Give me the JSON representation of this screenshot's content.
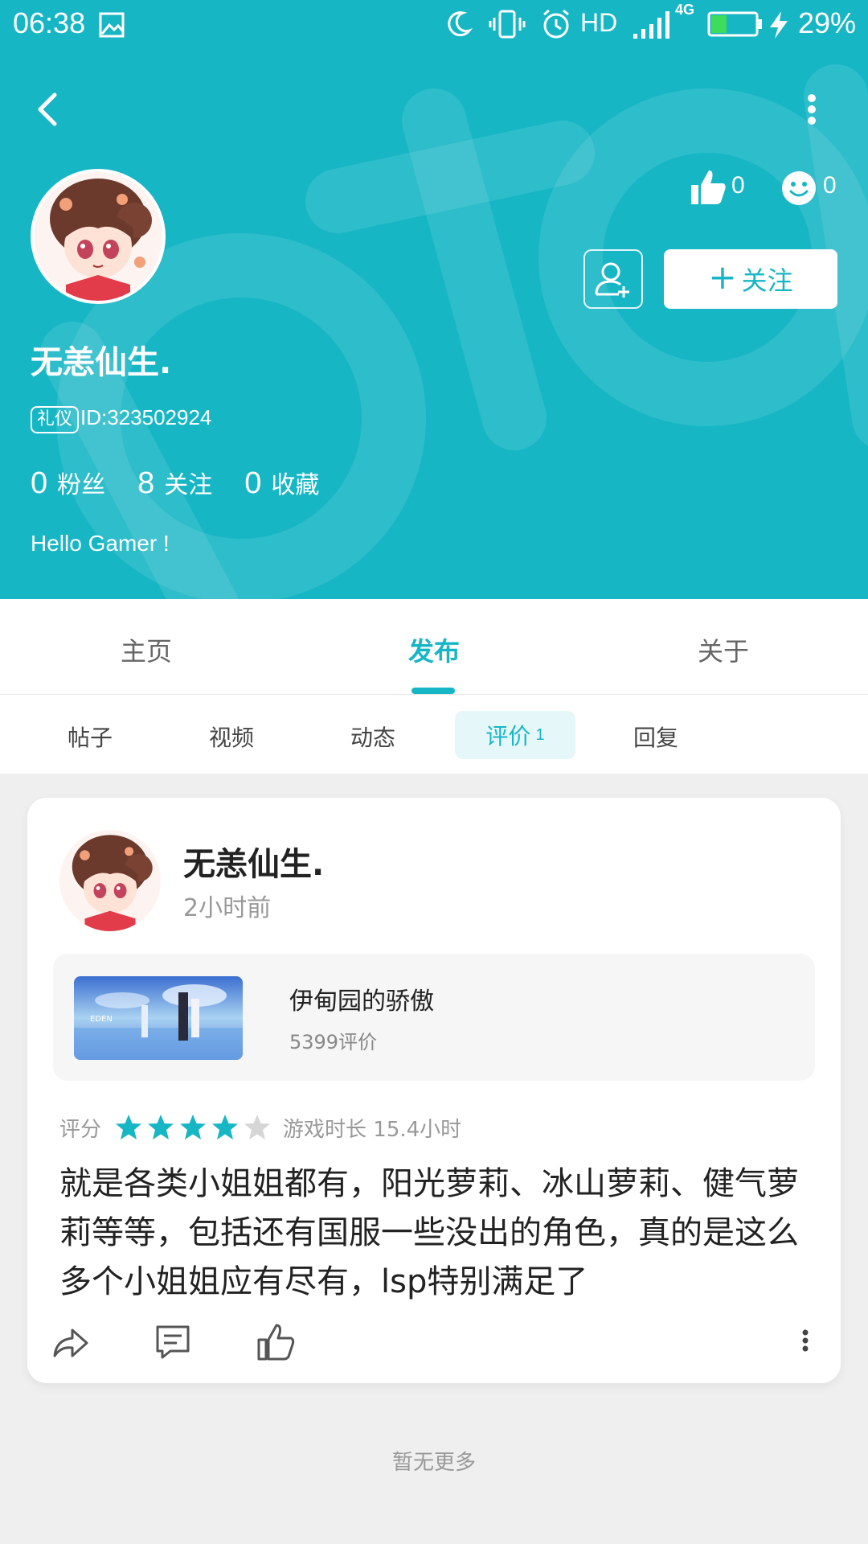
{
  "status_bar": {
    "time": "06:38",
    "hd": "HD",
    "network": "4G",
    "battery_percent": "29%"
  },
  "profile": {
    "username": "无恙仙生.",
    "tag": "礼仪",
    "id_text": "ID:323502924",
    "likes": "0",
    "smiles": "0",
    "follow_label": "关注",
    "follow_plus": "+",
    "counts": [
      {
        "num": "0",
        "label": "粉丝"
      },
      {
        "num": "8",
        "label": "关注"
      },
      {
        "num": "0",
        "label": "收藏"
      }
    ],
    "bio": "Hello Gamer !"
  },
  "tabs": [
    "主页",
    "发布",
    "关于"
  ],
  "active_tab": "发布",
  "subtabs": [
    "帖子",
    "视频",
    "动态",
    "回复"
  ],
  "active_subtab": {
    "label": "评价",
    "count": "1"
  },
  "review_card": {
    "author": "无恙仙生.",
    "time": "2小时前",
    "game": {
      "title": "伊甸园的骄傲",
      "review_count": "5399评价"
    },
    "rating_label": "评分",
    "rating": 4,
    "rating_max": 5,
    "playtime": "游戏时长 15.4小时",
    "content": "就是各类小姐姐都有，阳光萝莉、冰山萝莉、健气萝莉等等，包括还有国服一些没出的角色，真的是这么多个小姐姐应有尽有，lsp特别满足了"
  },
  "footer_text": "暂无更多",
  "colors": {
    "accent": "#17b6c5",
    "star_filled": "#17b6c5",
    "star_empty": "#d6d6d6"
  }
}
